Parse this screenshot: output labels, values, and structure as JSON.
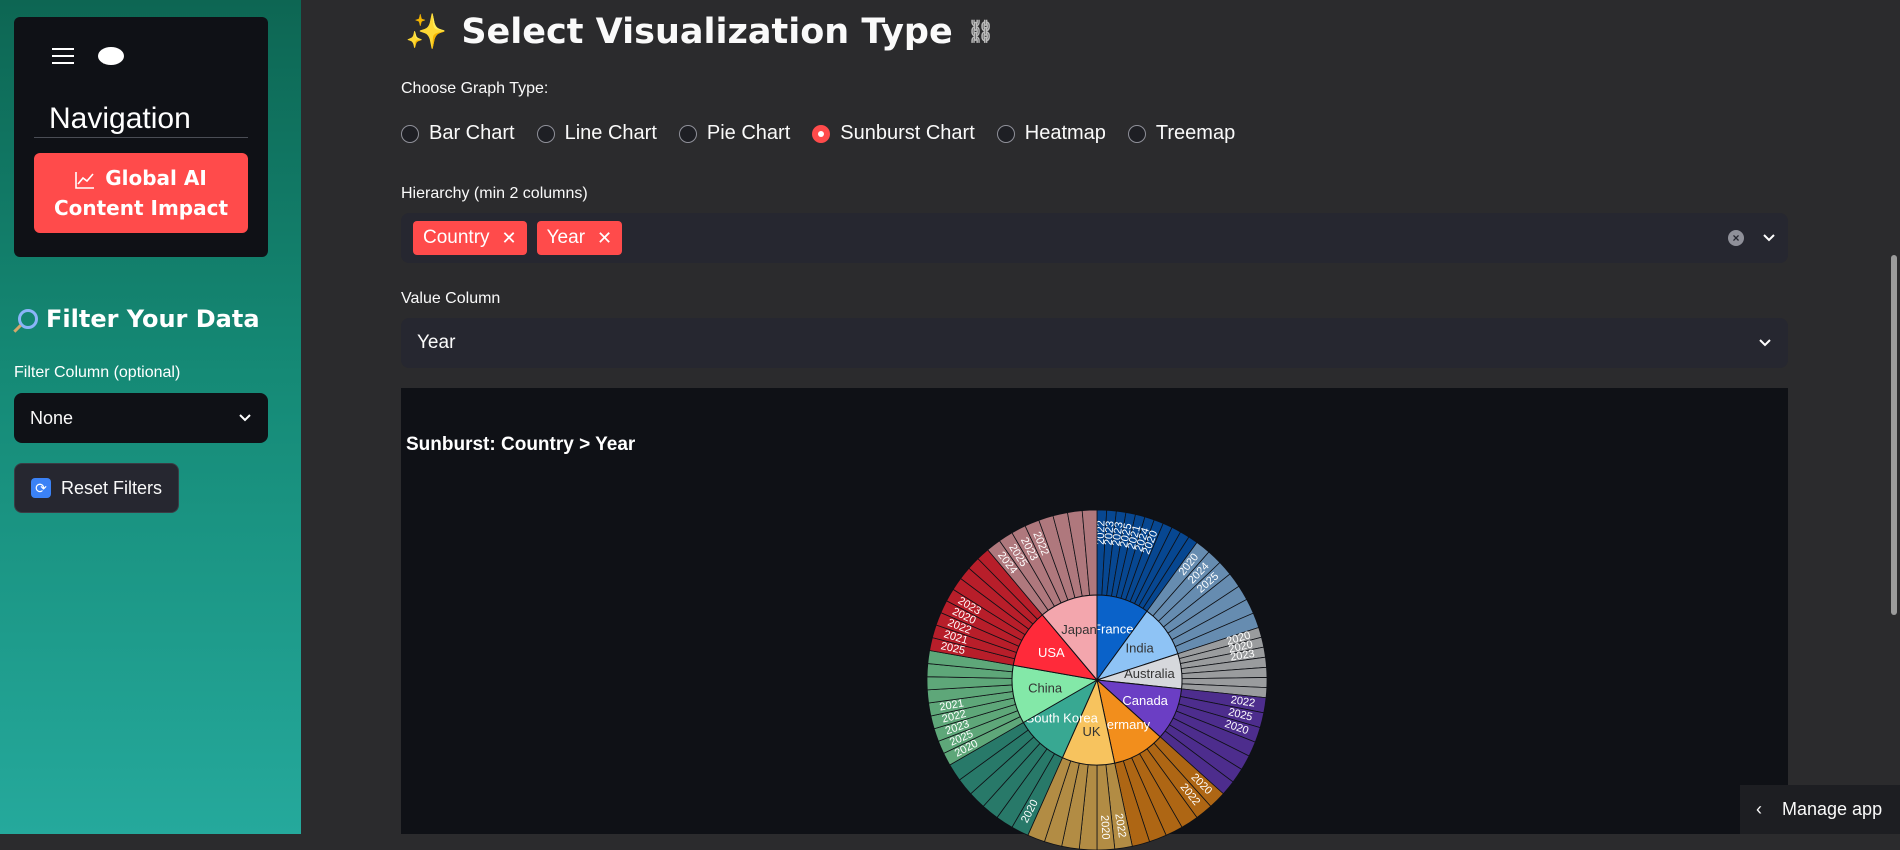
{
  "sidebar": {
    "nav_title": "Navigation",
    "primary_button": "Global AI Content Impact",
    "filter_heading": "Filter Your Data",
    "filter_label": "Filter Column (optional)",
    "filter_value": "None",
    "reset_button": "Reset Filters"
  },
  "main": {
    "title": "Select Visualization Type",
    "graph_type_label": "Choose Graph Type:",
    "graph_types": [
      {
        "label": "Bar Chart",
        "selected": false
      },
      {
        "label": "Line Chart",
        "selected": false
      },
      {
        "label": "Pie Chart",
        "selected": false
      },
      {
        "label": "Sunburst Chart",
        "selected": true
      },
      {
        "label": "Heatmap",
        "selected": false
      },
      {
        "label": "Treemap",
        "selected": false
      }
    ],
    "hierarchy_label": "Hierarchy (min 2 columns)",
    "hierarchy_tags": [
      "Country",
      "Year"
    ],
    "value_label": "Value Column",
    "value_selected": "Year",
    "chart_title": "Sunburst: Country > Year",
    "manage_app": "Manage app"
  },
  "colors": {
    "accent": "#ff4b4b",
    "panel": "#262730",
    "plot_bg": "#0f1116"
  },
  "chart_data": {
    "type": "sunburst",
    "title": "Sunburst: Country > Year",
    "levels": [
      "Country",
      "Year"
    ],
    "inner": [
      {
        "name": "France",
        "color": "#0a62c9"
      },
      {
        "name": "India",
        "color": "#8ec3f5"
      },
      {
        "name": "Australia",
        "color": "#d6d8dc"
      },
      {
        "name": "Canada",
        "color": "#6b3ec4"
      },
      {
        "name": "Germany",
        "color": "#f28e1c"
      },
      {
        "name": "UK",
        "color": "#f7c35e"
      },
      {
        "name": "South Korea",
        "color": "#38a892"
      },
      {
        "name": "China",
        "color": "#83e8a8"
      },
      {
        "name": "USA",
        "color": "#ff2a3a"
      },
      {
        "name": "Japan",
        "color": "#f3a6ad"
      }
    ],
    "outer_labels": [
      {
        "country": "France",
        "labels": [
          "2022",
          "2023",
          "2023",
          "2025",
          "2021",
          "2024",
          "2020"
        ]
      },
      {
        "country": "India",
        "labels": [
          "2020",
          "2024",
          "2025"
        ]
      },
      {
        "country": "Australia",
        "labels": [
          "2020",
          "2020",
          "2023"
        ]
      },
      {
        "country": "Canada",
        "labels": [
          "2022",
          "2025",
          "2020"
        ]
      },
      {
        "country": "USA",
        "labels": [
          "2025",
          "2021",
          "2022",
          "2020",
          "2023"
        ]
      },
      {
        "country": "Japan",
        "labels": [
          "2024",
          "2025",
          "2023",
          "2022"
        ]
      },
      {
        "country": "China",
        "labels": [
          "2020",
          "2025",
          "2023",
          "2022",
          "2021"
        ]
      },
      {
        "country": "South Korea",
        "labels": [
          "2020"
        ]
      },
      {
        "country": "UK",
        "labels": [
          "2022",
          "2020"
        ]
      },
      {
        "country": "Germany",
        "labels": [
          "2020",
          "2022"
        ]
      }
    ]
  }
}
